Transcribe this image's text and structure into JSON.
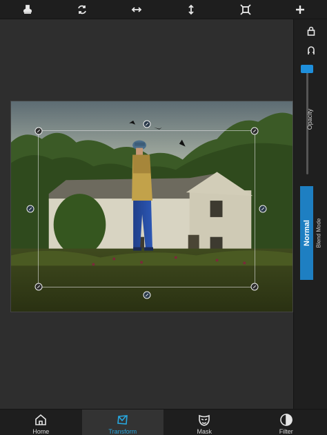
{
  "toolbar": {
    "items": [
      {
        "icon": "stamp-icon"
      },
      {
        "icon": "rotate-icon"
      },
      {
        "icon": "flip-horizontal-icon"
      },
      {
        "icon": "flip-vertical-icon"
      },
      {
        "icon": "fit-to-frame-icon"
      },
      {
        "icon": "add-icon"
      }
    ]
  },
  "right_panel": {
    "lock_icon": "lock-icon",
    "magnet_icon": "magnet-icon",
    "opacity_label": "Opacity",
    "opacity_value": 1.0,
    "accent_color": "#1e8fdc",
    "blend_mode_value": "Normal",
    "blend_mode_caption": "Blend Mode"
  },
  "tabs": [
    {
      "label": "Home",
      "icon": "home-icon",
      "active": false
    },
    {
      "label": "Transform",
      "icon": "transform-icon",
      "active": true
    },
    {
      "label": "Mask",
      "icon": "mask-icon",
      "active": false
    },
    {
      "label": "Filter",
      "icon": "filter-icon",
      "active": false
    }
  ],
  "colors": {
    "active_tab": "#27a8e0",
    "background": "#2e2e2e",
    "toolbar": "#1e1e1e"
  }
}
